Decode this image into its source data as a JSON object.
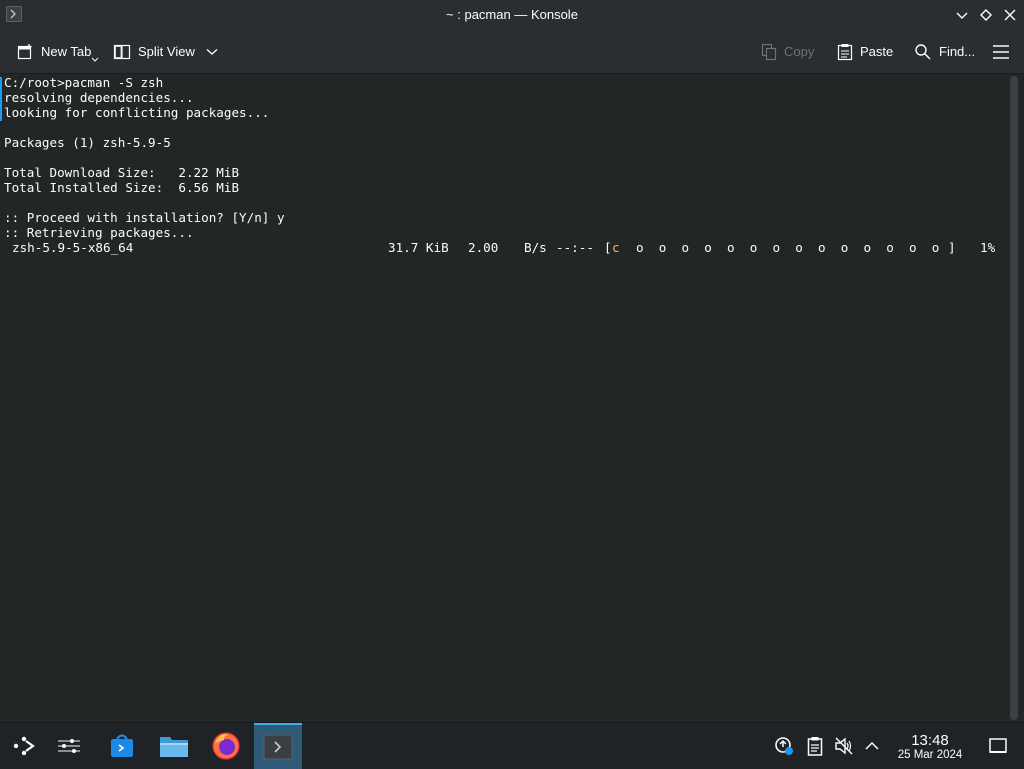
{
  "window": {
    "title": "~ : pacman — Konsole"
  },
  "toolbar": {
    "new_tab_label": "New Tab",
    "split_view_label": "Split View",
    "copy_label": "Copy",
    "paste_label": "Paste",
    "find_label": "Find..."
  },
  "terminal": {
    "lines": [
      "C:/root>pacman -S zsh",
      "resolving dependencies...",
      "looking for conflicting packages...",
      "",
      "Packages (1) zsh-5.9-5",
      "",
      "Total Download Size:   2.22 MiB",
      "Total Installed Size:  6.56 MiB",
      "",
      ":: Proceed with installation? [Y/n] y",
      ":: Retrieving packages..."
    ],
    "download": {
      "package": "zsh-5.9-5-x86_64",
      "size": "31.7 KiB",
      "rate": "2.00",
      "rate_unit": "B/s",
      "eta": "--:--",
      "bar_open": "[",
      "pacman_char": "c",
      "dots": "o  o  o  o  o  o  o  o  o  o  o  o  o  o",
      "bar_close": "]",
      "percent": "1%",
      "progress_fraction": 0.01
    }
  },
  "taskbar": {
    "time": "13:48",
    "date": "25 Mar 2024",
    "icons": [
      "app-launcher-icon",
      "pager-icon",
      "discover-icon",
      "dolphin-icon",
      "firefox-icon",
      "konsole-icon"
    ],
    "tray_icons": [
      "network-icon",
      "clipboard-icon",
      "volume-muted-icon",
      "show-hidden-icon",
      "show-desktop-icon"
    ]
  },
  "colors": {
    "background": "#232627",
    "accent": "#3daee9",
    "pacman": "#fdbc4b"
  }
}
